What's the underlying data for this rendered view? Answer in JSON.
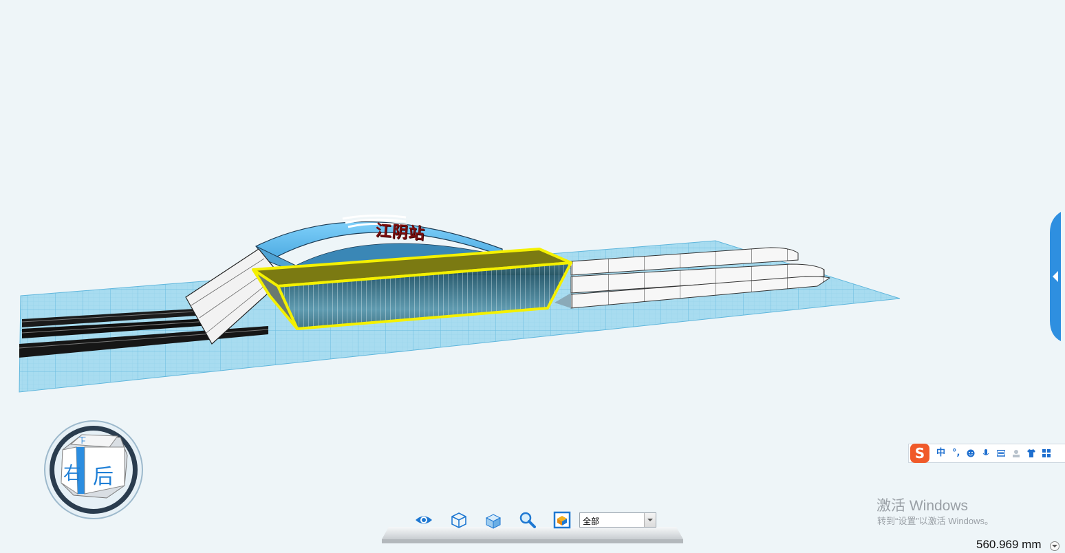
{
  "scene": {
    "station_name": "江阴站"
  },
  "navcube": {
    "top_label": "上",
    "right_label": "右",
    "back_label": "后"
  },
  "ime": {
    "logo": "S",
    "mode": "中",
    "punct": "°,"
  },
  "watermark": {
    "line1": "激活 Windows",
    "line2": "转到“设置”以激活 Windows。"
  },
  "toolbar": {
    "icons": [
      "eye-icon",
      "wireframe-cube-icon",
      "solid-cube-icon",
      "zoom-icon",
      "fit-view-icon"
    ],
    "filter_value": "全部"
  },
  "status": {
    "measurement": "560.969 mm"
  },
  "colors": {
    "background": "#eef5f8",
    "grid": "#7cc6e3",
    "roof": "#6ec3f2",
    "selection": "#f2f000",
    "accent": "#1f7fd6"
  }
}
